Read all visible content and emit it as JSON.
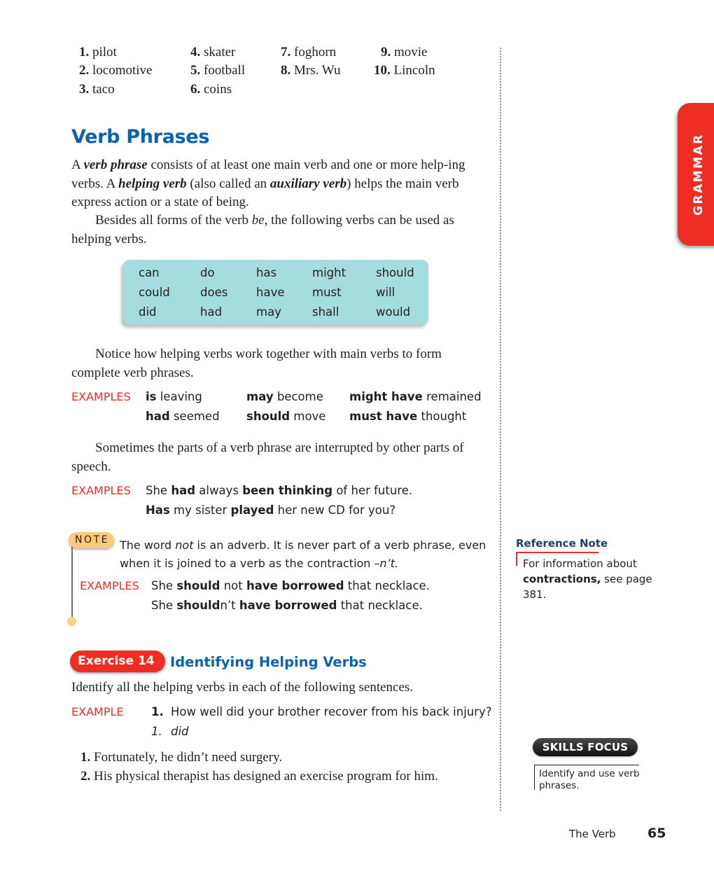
{
  "word_list": [
    {
      "num": "1.",
      "word": "pilot"
    },
    {
      "num": "2.",
      "word": "locomotive"
    },
    {
      "num": "3.",
      "word": "taco"
    },
    {
      "num": "4.",
      "word": "skater"
    },
    {
      "num": "5.",
      "word": "football"
    },
    {
      "num": "6.",
      "word": "coins"
    },
    {
      "num": "7.",
      "word": "foghorn"
    },
    {
      "num": "8.",
      "word": "Mrs. Wu"
    },
    {
      "num": "9.",
      "word": "movie"
    },
    {
      "num": "10.",
      "word": "Lincoln"
    }
  ],
  "side_tab": {
    "label": "GRAMMAR",
    "color": "#ee2e24"
  },
  "section": {
    "title": "Verb Phrases",
    "title_color": "#0b62ae",
    "intro": {
      "p1_a": "A ",
      "p1_term1": "verb phrase",
      "p1_b": " consists of at least one main verb and one or more help-ing verbs. A ",
      "p1_term2": "helping verb",
      "p1_c": " (also called an ",
      "p1_term3": "auxiliary verb",
      "p1_d": ") helps the main verb express action or a state of being.",
      "p2_a": "Besides all forms of the verb ",
      "p2_be": "be",
      "p2_b": ", the following verbs can be used as helping verbs."
    }
  },
  "helping_verbs": {
    "background": "#a5dcdd",
    "columns": [
      [
        "can",
        "could",
        "did"
      ],
      [
        "do",
        "does",
        "had"
      ],
      [
        "has",
        "have",
        "may"
      ],
      [
        "might",
        "must",
        "shall"
      ],
      [
        "should",
        "will",
        "would"
      ]
    ]
  },
  "paragraph_notice": "Notice how helping verbs work together with main verbs to form complete verb phrases.",
  "examples_1": {
    "label": "EXAMPLES",
    "items": [
      {
        "bold": "is",
        "rest": " leaving"
      },
      {
        "bold": "may",
        "rest": " become"
      },
      {
        "bold": "might have",
        "rest": " remained"
      },
      {
        "bold": "had",
        "rest": " seemed"
      },
      {
        "bold": "should",
        "rest": " move"
      },
      {
        "bold": "must have",
        "rest": " thought"
      }
    ]
  },
  "paragraph_interrupted": "Sometimes the parts of a verb phrase are interrupted by other parts of speech.",
  "examples_2": {
    "label": "EXAMPLES",
    "line1": {
      "a": "She ",
      "b1": "had",
      "c": " always ",
      "b2": "been thinking",
      "d": " of her future."
    },
    "line2": {
      "b1": "Has",
      "a": " my sister ",
      "b2": "played",
      "c": " her new CD for you?"
    }
  },
  "note": {
    "badge": "NOTE",
    "text_a": "The word ",
    "text_not": "not",
    "text_b": " is an adverb. It is never part of a verb phrase, even when it is joined to a verb as the contraction ",
    "text_nt": "–n’t.",
    "examples_label": "EXAMPLES",
    "line1": {
      "a": "She ",
      "b1": "should",
      "c": " not ",
      "b2": "have borrowed",
      "d": " that necklace."
    },
    "line2": {
      "a": "She ",
      "b1": "should",
      "c": "n’t ",
      "b2": "have borrowed",
      "d": " that necklace."
    }
  },
  "reference_note": {
    "title": "Reference Note",
    "text_a": "For information about ",
    "text_bold": "contractions,",
    "text_b": " see page 381."
  },
  "exercise": {
    "badge": "Exercise 14",
    "title": "Identifying Helping Verbs",
    "instructions": "Identify all the helping verbs in each of the following sentences.",
    "example_label": "EXAMPLE",
    "example_num": "1.",
    "example_sentence": "How well did your brother recover from his back injury?",
    "example_answer_num": "1.",
    "example_answer": "did",
    "items": [
      {
        "num": "1.",
        "text": "Fortunately, he didn’t need surgery."
      },
      {
        "num": "2.",
        "text": "His physical therapist has designed an exercise program for him."
      }
    ]
  },
  "skills_focus": {
    "badge": "SKILLS FOCUS",
    "text": "Identify and use verb phrases."
  },
  "footer": {
    "chapter": "The Verb",
    "page": "65"
  },
  "colors": {
    "accent_red": "#ee2e24",
    "heading_blue": "#0b62ae",
    "note_orange": "#fdc97a"
  }
}
